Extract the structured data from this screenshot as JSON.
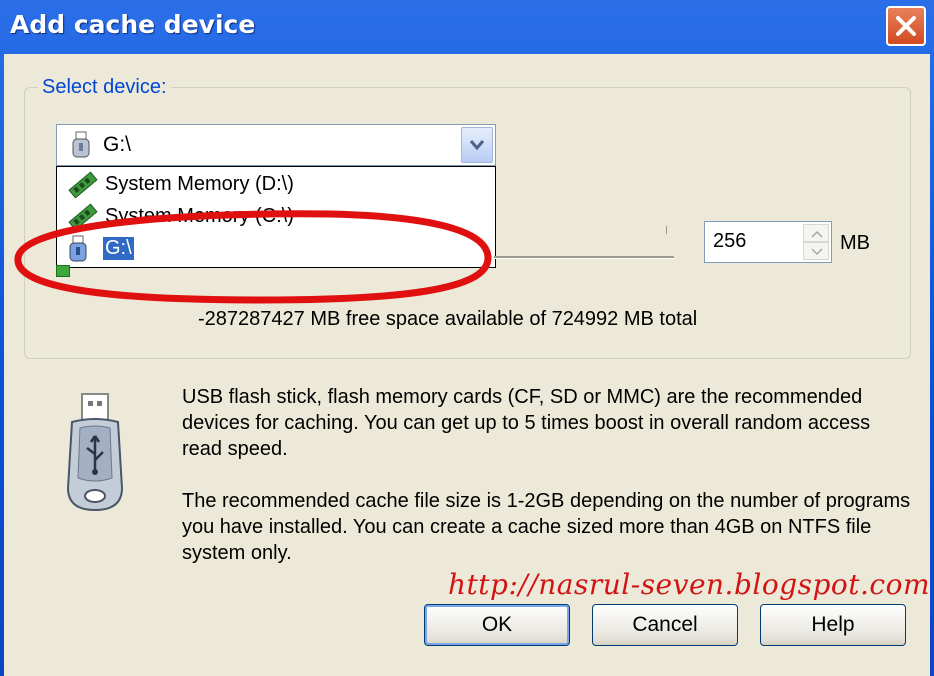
{
  "window": {
    "title": "Add cache device"
  },
  "select_device": {
    "label": "Select device:",
    "selected_value": "G:\\",
    "options": [
      {
        "label": "System Memory (D:\\)",
        "icon": "memory-icon"
      },
      {
        "label": "System Memory (C:\\)",
        "icon": "memory-icon"
      },
      {
        "label": "G:\\",
        "icon": "usb-drive-icon",
        "highlighted": true
      }
    ]
  },
  "cache_size": {
    "value": "256",
    "unit": "MB"
  },
  "free_space_text": "-287287427 MB free space available of 724992 MB total",
  "info": {
    "paragraph1": "USB flash stick, flash memory cards (CF, SD or MMC) are the recommended devices for caching. You can get up to 5 times boost in overall random access read speed.",
    "paragraph2": "The recommended cache file size is 1-2GB depending on the number of programs you have installed. You can create a cache sized more than 4GB on NTFS file system only."
  },
  "watermark": "http://nasrul-seven.blogspot.com",
  "buttons": {
    "ok": "OK",
    "cancel": "Cancel",
    "help": "Help"
  },
  "colors": {
    "title_bar": "#0b4fd4",
    "highlight": "#316ac5",
    "annotation": "#e01010",
    "group_label": "#0046d5"
  }
}
